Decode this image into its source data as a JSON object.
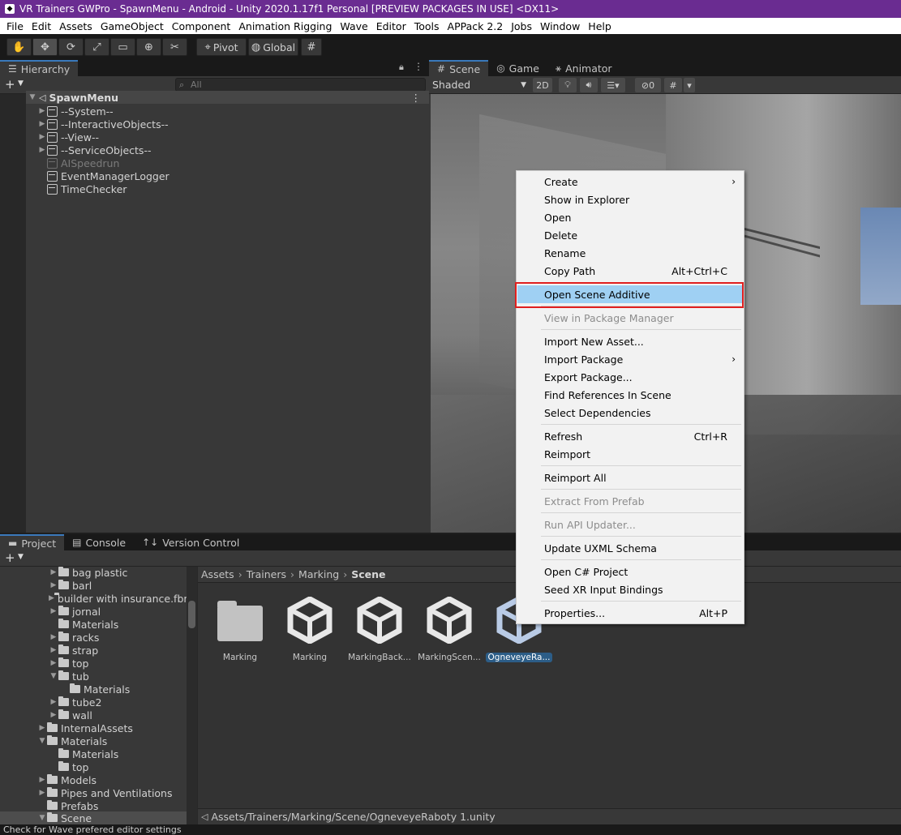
{
  "title_bar": {
    "title": "VR Trainers GWPro - SpawnMenu - Android - Unity 2020.1.17f1 Personal [PREVIEW PACKAGES IN USE] <DX11>"
  },
  "menu": [
    "File",
    "Edit",
    "Assets",
    "GameObject",
    "Component",
    "Animation Rigging",
    "Wave",
    "Editor",
    "Tools",
    "APPack 2.2",
    "Jobs",
    "Window",
    "Help"
  ],
  "toolbar": {
    "pivot_label": "Pivot",
    "global_label": "Global"
  },
  "hierarchy": {
    "tab_label": "Hierarchy",
    "search_placeholder": "All",
    "scene_name": "SpawnMenu",
    "items": [
      {
        "label": "--System--"
      },
      {
        "label": "--InteractiveObjects--"
      },
      {
        "label": "--View--"
      },
      {
        "label": "--ServiceObjects--"
      },
      {
        "label": "AISpeedrun"
      },
      {
        "label": "EventManagerLogger"
      },
      {
        "label": "TimeChecker"
      }
    ]
  },
  "scene_view": {
    "tabs": [
      "Scene",
      "Game",
      "Animator"
    ],
    "shading_mode": "Shaded",
    "mode_2d": "2D",
    "hidden_count": "0"
  },
  "project": {
    "tabs": [
      "Project",
      "Console",
      "Version Control"
    ],
    "tree": [
      {
        "label": "bag plastic"
      },
      {
        "label": "barl"
      },
      {
        "label": "builder with insurance.fbm"
      },
      {
        "label": "jornal"
      },
      {
        "label": "Materials"
      },
      {
        "label": "racks"
      },
      {
        "label": "strap"
      },
      {
        "label": "top"
      },
      {
        "label": "tub"
      },
      {
        "label": "Materials"
      },
      {
        "label": "tube2"
      },
      {
        "label": "wall"
      },
      {
        "label": "InternalAssets"
      },
      {
        "label": "Materials"
      },
      {
        "label": "Materials"
      },
      {
        "label": "top"
      },
      {
        "label": "Models"
      },
      {
        "label": "Pipes and Ventilations"
      },
      {
        "label": "Prefabs"
      },
      {
        "label": "Scene"
      }
    ],
    "breadcrumb": [
      "Assets",
      "Trainers",
      "Marking",
      "Scene"
    ],
    "assets": [
      {
        "name": "Marking"
      },
      {
        "name": "Marking"
      },
      {
        "name": "MarkingBack..."
      },
      {
        "name": "MarkingScen..."
      },
      {
        "name": "OgneveyeRa..."
      }
    ],
    "selected_path": "Assets/Trainers/Marking/Scene/OgneveyeRaboty 1.unity"
  },
  "status_bar": {
    "text": "Check for Wave prefered editor settings"
  },
  "context_menu": {
    "items": [
      {
        "label": "Create",
        "shortcut": "",
        "submenu": true
      },
      {
        "label": "Show in Explorer",
        "shortcut": ""
      },
      {
        "label": "Open",
        "shortcut": ""
      },
      {
        "label": "Delete",
        "shortcut": ""
      },
      {
        "label": "Rename",
        "shortcut": ""
      },
      {
        "label": "Copy Path",
        "shortcut": "Alt+Ctrl+C"
      },
      {
        "label": "Open Scene Additive",
        "shortcut": "",
        "highlighted": true
      },
      {
        "label": "View in Package Manager",
        "shortcut": "",
        "disabled": true
      },
      {
        "label": "Import New Asset...",
        "shortcut": ""
      },
      {
        "label": "Import Package",
        "shortcut": "",
        "submenu": true
      },
      {
        "label": "Export Package...",
        "shortcut": ""
      },
      {
        "label": "Find References In Scene",
        "shortcut": ""
      },
      {
        "label": "Select Dependencies",
        "shortcut": ""
      },
      {
        "label": "Refresh",
        "shortcut": "Ctrl+R"
      },
      {
        "label": "Reimport",
        "shortcut": ""
      },
      {
        "label": "Reimport All",
        "shortcut": ""
      },
      {
        "label": "Extract From Prefab",
        "shortcut": "",
        "disabled": true
      },
      {
        "label": "Run API Updater...",
        "shortcut": "",
        "disabled": true
      },
      {
        "label": "Update UXML Schema",
        "shortcut": ""
      },
      {
        "label": "Open C# Project",
        "shortcut": ""
      },
      {
        "label": "Seed XR Input Bindings",
        "shortcut": ""
      },
      {
        "label": "Properties...",
        "shortcut": "Alt+P"
      }
    ]
  },
  "colors": {
    "title_bar": "#6a2c91",
    "highlight": "#9fd0f3",
    "annotation_box": "#e01f1f",
    "selection": "#2c5d87"
  }
}
